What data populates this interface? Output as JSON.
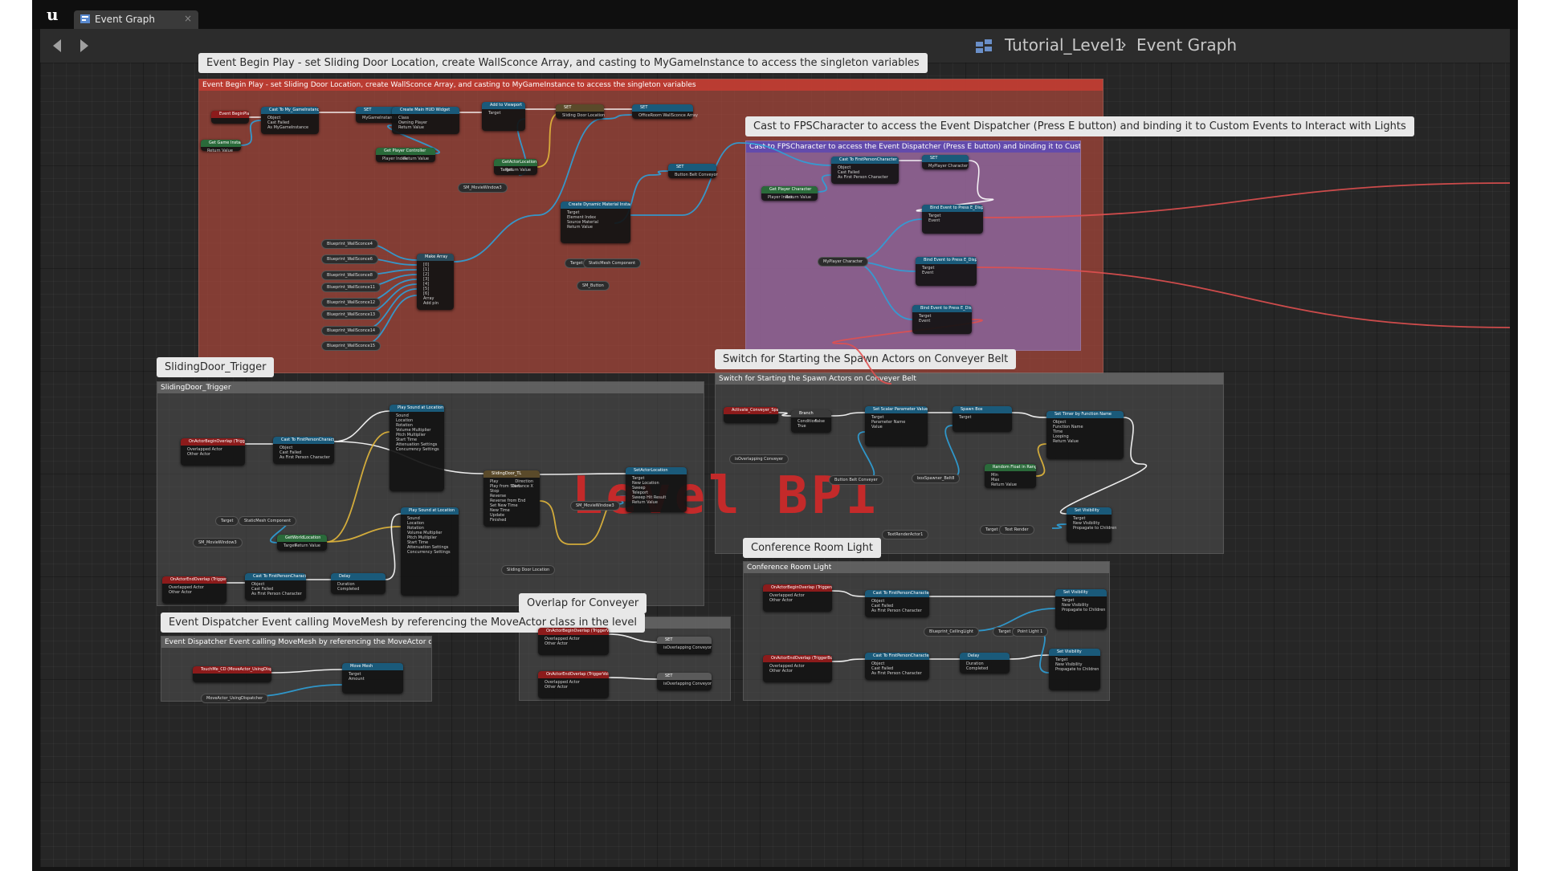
{
  "tab": {
    "label": "Event Graph",
    "close": "×"
  },
  "nav": {
    "back": "back-arrow-icon",
    "forward": "forward-arrow-icon"
  },
  "breadcrumb": {
    "level": "Tutorial_Level1",
    "separator": "›",
    "graph": "Event Graph"
  },
  "watermark": "Level BP1",
  "comments": [
    {
      "bubble": "Event Begin Play - set Sliding Door Location, create WallSconce Array,  and casting to MyGameInstance to access the singleton variables",
      "header": "Event Begin Play - set Sliding Door Location, create WallSconce Array,  and casting to MyGameInstance to access the singleton variables",
      "color": "#a8463a"
    },
    {
      "bubble": "Cast to FPSCharacter to access the Event Dispatcher (Press E button) and binding it to Custom Events to Interact with Lights",
      "header": "Cast to FPSCharacter to access the Event Dispatcher (Press E button) and binding it to Custom Events to Interact with Lights",
      "color": "#8a6aa8"
    },
    {
      "bubble": "SlidingDoor_Trigger",
      "header": "SlidingDoor_Trigger",
      "color": "#555555"
    },
    {
      "bubble": "Switch for Starting the Spawn Actors on Conveyer Belt",
      "header": "Switch for Starting the Spawn Actors on Conveyer Belt",
      "color": "#555555"
    },
    {
      "bubble": "Conference Room Light",
      "header": "Conference Room Light",
      "color": "#555555"
    },
    {
      "bubble": "Overlap for Conveyer",
      "header": "Overlap for Conveyer",
      "color": "#555555"
    },
    {
      "bubble": "Event Dispatcher Event calling MoveMesh by referencing the MoveActor class in the level",
      "header": "Event Dispatcher Event calling MoveMesh by referencing the MoveActor class in the level",
      "color": "#555555"
    }
  ],
  "nodes": [
    {
      "title": "Event BeginPlay",
      "color": "#8c1b1b",
      "pins": []
    },
    {
      "title": "Cast To My_GameInstance",
      "color": "#1a5a7a",
      "pins": [
        "Object",
        "Cast Failed",
        "As MyGameInstance"
      ]
    },
    {
      "title": "SET",
      "color": "#1a5a7a",
      "pins": [
        "MyGameInstance"
      ]
    },
    {
      "title": "Create Main HUD Widget",
      "color": "#1a5a7a",
      "pins": [
        "Class",
        "Owning Player",
        "Return Value"
      ]
    },
    {
      "title": "Add to Viewport",
      "color": "#1a5a7a",
      "pins": [
        "Target"
      ]
    },
    {
      "title": "SET",
      "color": "#5a4a2a",
      "pins": [
        "Sliding Door Location"
      ]
    },
    {
      "title": "SET",
      "color": "#1a5a7a",
      "pins": [
        "OfficeRoom WallSconce Array"
      ]
    },
    {
      "title": "Get Game Instance",
      "color": "#2a6a3a",
      "pins": [
        "Return Value"
      ]
    },
    {
      "title": "Get Player Controller",
      "color": "#2a6a3a",
      "pins": [
        "Player Index",
        "Return Value"
      ]
    },
    {
      "title": "GetActorLocation",
      "color": "#2a6a3a",
      "pins": [
        "Target",
        "Return Value"
      ]
    },
    {
      "title": "SET",
      "color": "#1a5a7a",
      "pins": [
        "Button Belt Conveyor"
      ]
    },
    {
      "title": "Create Dynamic Material Instance",
      "color": "#1a5a7a",
      "pins": [
        "Target",
        "Element Index",
        "Source Material",
        "Return Value"
      ]
    },
    {
      "title": "Make Array",
      "color": "#2a4a5a",
      "pins": [
        "[0]",
        "[1]",
        "[2]",
        "[3]",
        "[4]",
        "[5]",
        "[6]",
        "Array",
        "Add pin"
      ]
    },
    {
      "title": "Cast To FirstPersonCharacter",
      "color": "#1a5a7a",
      "pins": [
        "Object",
        "Cast Failed",
        "As First Person Character"
      ]
    },
    {
      "title": "SET",
      "color": "#1a5a7a",
      "pins": [
        "MyPlayer Character"
      ]
    },
    {
      "title": "Get Player Character",
      "color": "#2a6a3a",
      "pins": [
        "Player Index",
        "Return Value"
      ]
    },
    {
      "title": "Bind Event to Press E_Dispatcher",
      "color": "#1a5a7a",
      "pins": [
        "Target",
        "Event"
      ]
    },
    {
      "title": "Bind Event to Press E_Dispatcher",
      "color": "#1a5a7a",
      "pins": [
        "Target",
        "Event"
      ]
    },
    {
      "title": "Bind Event to Press E_Dispatcher",
      "color": "#1a5a7a",
      "pins": [
        "Target",
        "Event"
      ]
    },
    {
      "title": "OnActorBeginOverlap (TriggerBox)",
      "color": "#8c1b1b",
      "pins": [
        "Overlapped Actor",
        "Other Actor"
      ]
    },
    {
      "title": "Cast To FirstPersonCharacter",
      "color": "#1a5a7a",
      "pins": [
        "Object",
        "Cast Failed",
        "As First Person Character"
      ]
    },
    {
      "title": "Play Sound at Location",
      "color": "#1a5a7a",
      "pins": [
        "Sound",
        "Location",
        "Rotation",
        "Volume Multiplier",
        "Pitch Multiplier",
        "Start Time",
        "Attenuation Settings",
        "Concurrency Settings"
      ]
    },
    {
      "title": "SlidingDoor_TL",
      "color": "#5a4a2a",
      "pins": [
        "Play",
        "Play from Start",
        "Stop",
        "Reverse",
        "Reverse from End",
        "Set New Time",
        "New Time",
        "Update",
        "Finished",
        "Direction",
        "Distance X"
      ]
    },
    {
      "title": "SetActorLocation",
      "color": "#1a5a7a",
      "pins": [
        "Target",
        "New Location",
        "Sweep",
        "Teleport",
        "Sweep Hit Result",
        "Return Value"
      ]
    },
    {
      "title": "Play Sound at Location",
      "color": "#1a5a7a",
      "pins": [
        "Sound",
        "Location",
        "Rotation",
        "Volume Multiplier",
        "Pitch Multiplier",
        "Start Time",
        "Attenuation Settings",
        "Concurrency Settings"
      ]
    },
    {
      "title": "GetWorldLocation",
      "color": "#2a6a3a",
      "pins": [
        "Target",
        "Return Value"
      ]
    },
    {
      "title": "OnActorEndOverlap (TriggerBox)",
      "color": "#8c1b1b",
      "pins": [
        "Overlapped Actor",
        "Other Actor"
      ]
    },
    {
      "title": "Cast To FirstPersonCharacter",
      "color": "#1a5a7a",
      "pins": [
        "Object",
        "Cast Failed",
        "As First Person Character"
      ]
    },
    {
      "title": "Delay",
      "color": "#1a5a7a",
      "pins": [
        "Duration",
        "Completed"
      ]
    },
    {
      "title": "Activate_Conveyer_Spawn",
      "color": "#8c1b1b",
      "pins": []
    },
    {
      "title": "Branch",
      "color": "#3a3a3a",
      "pins": [
        "Condition",
        "True",
        "False"
      ]
    },
    {
      "title": "Set Scalar Parameter Value",
      "color": "#1a5a7a",
      "pins": [
        "Target",
        "Parameter Name",
        "Value"
      ]
    },
    {
      "title": "Spawn Box",
      "color": "#1a5a7a",
      "pins": [
        "Target"
      ]
    },
    {
      "title": "Set Timer by Function Name",
      "color": "#1a5a7a",
      "pins": [
        "Object",
        "Function Name",
        "Time",
        "Looping",
        "Return Value"
      ]
    },
    {
      "title": "Random Float in Range",
      "color": "#2a6a3a",
      "pins": [
        "Min",
        "Max",
        "Return Value"
      ]
    },
    {
      "title": "Set Visibility",
      "color": "#1a5a7a",
      "pins": [
        "Target",
        "New Visibility",
        "Propagate to Children"
      ]
    },
    {
      "title": "OnActorBeginOverlap (TriggerBox)",
      "color": "#8c1b1b",
      "pins": [
        "Overlapped Actor",
        "Other Actor"
      ]
    },
    {
      "title": "Cast To FirstPersonCharacter",
      "color": "#1a5a7a",
      "pins": [
        "Object",
        "Cast Failed",
        "As First Person Character"
      ]
    },
    {
      "title": "Set Visibility",
      "color": "#1a5a7a",
      "pins": [
        "Target",
        "New Visibility",
        "Propagate to Children"
      ]
    },
    {
      "title": "OnActorEndOverlap (TriggerBox)",
      "color": "#8c1b1b",
      "pins": [
        "Overlapped Actor",
        "Other Actor"
      ]
    },
    {
      "title": "Cast To FirstPersonCharacter",
      "color": "#1a5a7a",
      "pins": [
        "Object",
        "Cast Failed",
        "As First Person Character"
      ]
    },
    {
      "title": "Delay",
      "color": "#1a5a7a",
      "pins": [
        "Duration",
        "Completed"
      ]
    },
    {
      "title": "Set Visibility",
      "color": "#1a5a7a",
      "pins": [
        "Target",
        "New Visibility",
        "Propagate to Children"
      ]
    },
    {
      "title": "OnActorBeginOverlap (TriggerVolume)",
      "color": "#8c1b1b",
      "pins": [
        "Overlapped Actor",
        "Other Actor"
      ]
    },
    {
      "title": "SET",
      "color": "#5a5a5a",
      "pins": [
        "isOverlapping Conveyor"
      ]
    },
    {
      "title": "OnActorEndOverlap (TriggerVolume)",
      "color": "#8c1b1b",
      "pins": [
        "Overlapped Actor",
        "Other Actor"
      ]
    },
    {
      "title": "SET",
      "color": "#5a5a5a",
      "pins": [
        "isOverlapping Conveyor"
      ]
    },
    {
      "title": "TouchMe_CD (MoveActor_UsingDispatcher)",
      "color": "#8c1b1b",
      "pins": []
    },
    {
      "title": "Move Mesh",
      "color": "#1a5a7a",
      "pins": [
        "Target",
        "Amount"
      ]
    }
  ],
  "vars": [
    "Blueprint_WallSconce4",
    "Blueprint_WallSconce6",
    "Blueprint_WallSconce8",
    "Blueprint_WallSconce11",
    "Blueprint_WallSconce12",
    "Blueprint_WallSconce13",
    "Blueprint_WallSconce14",
    "Blueprint_WallSconce15",
    "SM_MovieWindow3",
    "Target",
    "StaticMesh Component",
    "SM_Button",
    "MyPlayer Character",
    "Target",
    "StaticMesh Component",
    "SM_MovieWindow3",
    "SM_MovieWindow3",
    "Sliding Door Location",
    "isOverlapping Conveyer",
    "Button Belt Conveyer",
    "boxSpawner_Belt8",
    "TextRenderActor1",
    "Target",
    "Text Render",
    "Blueprint_CeilingLight",
    "Target",
    "Point Light 1",
    "MoveActor_UsingDispatcher"
  ],
  "colors": {
    "exec": "#ffffff",
    "object": "#2ea0d8",
    "vector": "#e2b73b",
    "event": "#e05050",
    "bool": "#8c1b1b"
  }
}
